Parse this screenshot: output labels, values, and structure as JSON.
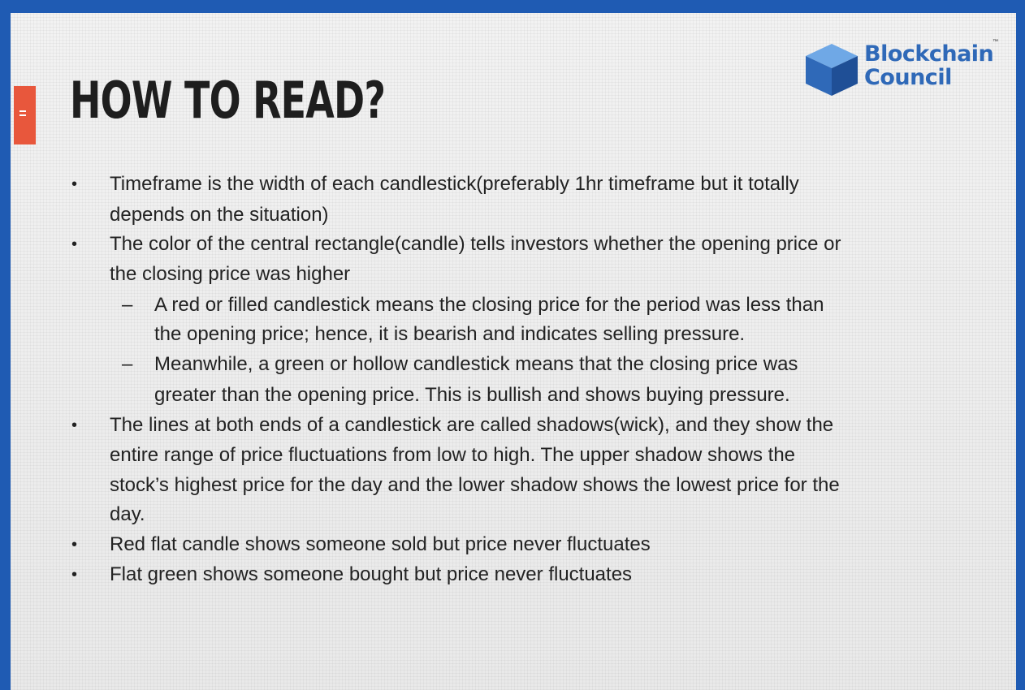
{
  "slide": {
    "title": "HOW TO READ?",
    "accent_color": "#e8573c",
    "border_color": "#1f5bb3"
  },
  "logo": {
    "line1": "Blockchain",
    "line2": "Council",
    "trademark": "™",
    "color": "#2f69b8",
    "icon": "cube-icon"
  },
  "bullets": [
    {
      "symbol": "•",
      "lines": [
        "Timeframe is the width of each candlestick(preferably 1hr timeframe but it totally",
        "depends on the situation)"
      ]
    },
    {
      "symbol": "•",
      "lines": [
        "The color of the central rectangle(candle) tells investors whether the opening price or",
        "the closing price was higher"
      ],
      "sub": [
        {
          "symbol": "–",
          "lines": [
            "A red or filled candlestick means the closing price for the period was less than",
            "the opening price; hence, it is bearish and indicates selling pressure."
          ]
        },
        {
          "symbol": "–",
          "lines": [
            "Meanwhile, a green or hollow candlestick means that the closing price was",
            "greater than the opening price. This is bullish and shows buying pressure."
          ]
        }
      ]
    },
    {
      "symbol": "•",
      "lines": [
        "The lines at both ends of a candlestick are called shadows(wick), and they show the",
        "entire range of price fluctuations from low to high. The upper shadow shows the",
        "stock’s highest price for the day and the lower shadow shows the lowest price for the",
        "day."
      ]
    },
    {
      "symbol": "•",
      "lines": [
        "Red flat candle shows someone sold but price never fluctuates"
      ]
    },
    {
      "symbol": "•",
      "lines": [
        "Flat green shows someone bought but price never fluctuates"
      ]
    }
  ]
}
